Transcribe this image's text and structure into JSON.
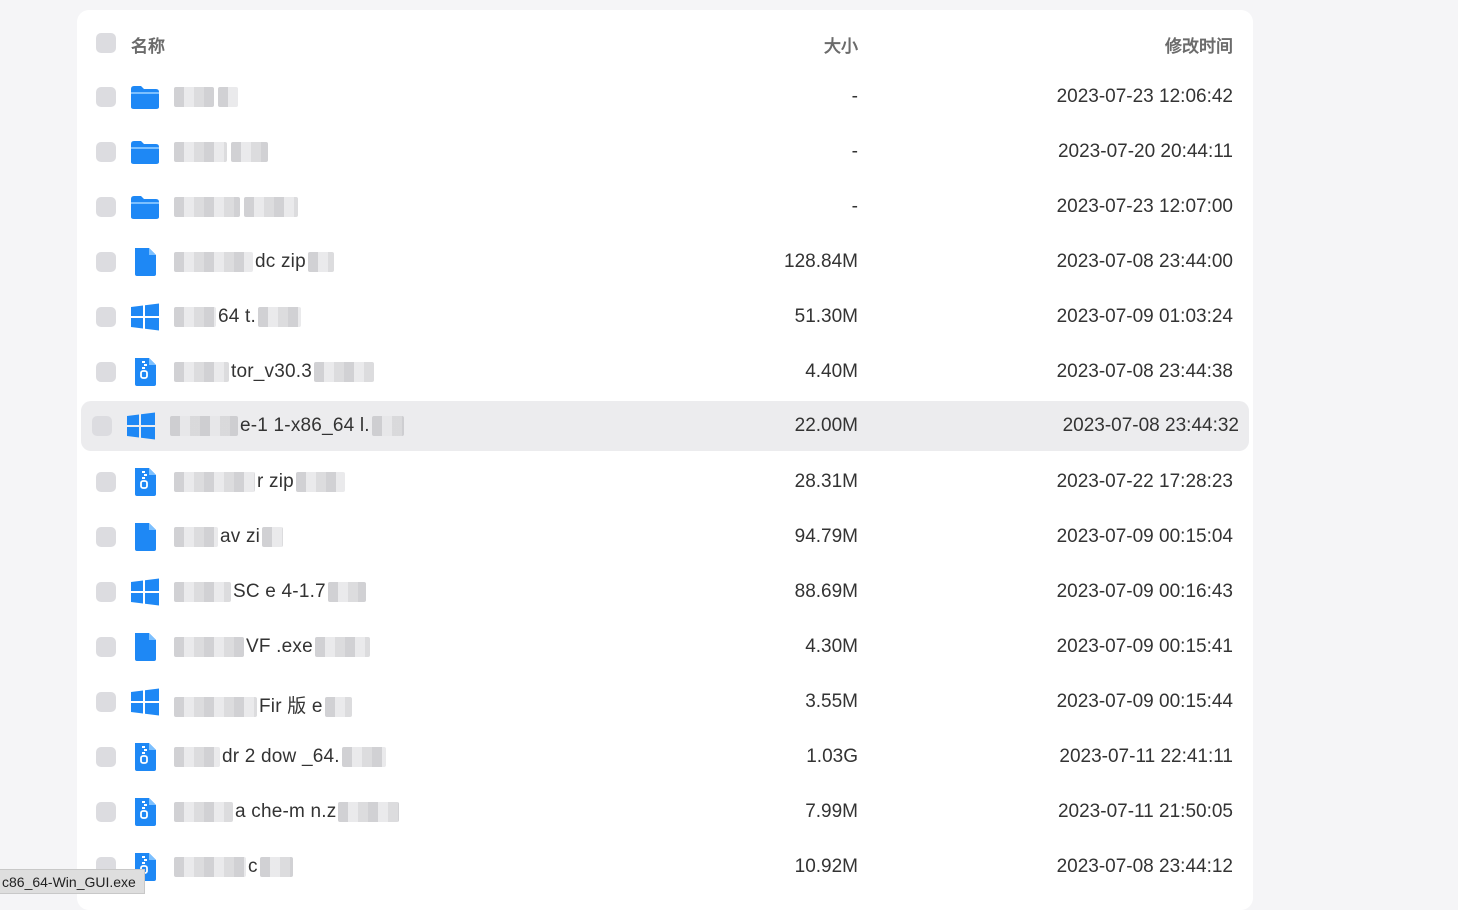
{
  "header": {
    "name_label": "名称",
    "size_label": "大小",
    "time_label": "修改时间"
  },
  "colors": {
    "folder": "#1e88f5",
    "windows": "#1e88f5",
    "archive": "#1e88f5",
    "selected_row": "#ececee"
  },
  "rows": [
    {
      "icon": "folder-icon",
      "name_visible": "",
      "size": "-",
      "time": "2023-07-23 12:06:42",
      "selected": false
    },
    {
      "icon": "folder-icon",
      "name_visible": "",
      "size": "-",
      "time": "2023-07-20 20:44:11",
      "selected": false
    },
    {
      "icon": "folder-icon",
      "name_visible": "",
      "size": "-",
      "time": "2023-07-23 12:07:00",
      "selected": false
    },
    {
      "icon": "document-icon",
      "name_visible": "dc zip",
      "size": "128.84M",
      "time": "2023-07-08 23:44:00",
      "selected": false
    },
    {
      "icon": "windows-icon",
      "name_visible": "64 t.",
      "size": "51.30M",
      "time": "2023-07-09 01:03:24",
      "selected": false
    },
    {
      "icon": "zip-icon",
      "name_visible": "tor_v30.3",
      "size": "4.40M",
      "time": "2023-07-08 23:44:38",
      "selected": false
    },
    {
      "icon": "windows-icon",
      "name_visible": "e-1 1-x86_64 l.",
      "size": "22.00M",
      "time": "2023-07-08 23:44:32",
      "selected": true
    },
    {
      "icon": "zip-icon",
      "name_visible": "r zip",
      "size": "28.31M",
      "time": "2023-07-22 17:28:23",
      "selected": false
    },
    {
      "icon": "document-icon",
      "name_visible": "av zi",
      "size": "94.79M",
      "time": "2023-07-09 00:15:04",
      "selected": false
    },
    {
      "icon": "windows-icon",
      "name_visible": "SC e 4-1.7",
      "size": "88.69M",
      "time": "2023-07-09 00:16:43",
      "selected": false
    },
    {
      "icon": "document-icon",
      "name_visible": "VF .exe",
      "size": "4.30M",
      "time": "2023-07-09 00:15:41",
      "selected": false
    },
    {
      "icon": "windows-icon",
      "name_visible": "Fir 版 e",
      "size": "3.55M",
      "time": "2023-07-09 00:15:44",
      "selected": false
    },
    {
      "icon": "zip-icon",
      "name_visible": "dr 2 dow _64.",
      "size": "1.03G",
      "time": "2023-07-11 22:41:11",
      "selected": false
    },
    {
      "icon": "zip-icon",
      "name_visible": "a che-m n.z",
      "size": "7.99M",
      "time": "2023-07-11 21:50:05",
      "selected": false
    },
    {
      "icon": "zip-icon",
      "name_visible": "c",
      "size": "10.92M",
      "time": "2023-07-08 23:44:12",
      "selected": false
    }
  ],
  "statusbar": {
    "text": "c86_64-Win_GUI.exe"
  }
}
